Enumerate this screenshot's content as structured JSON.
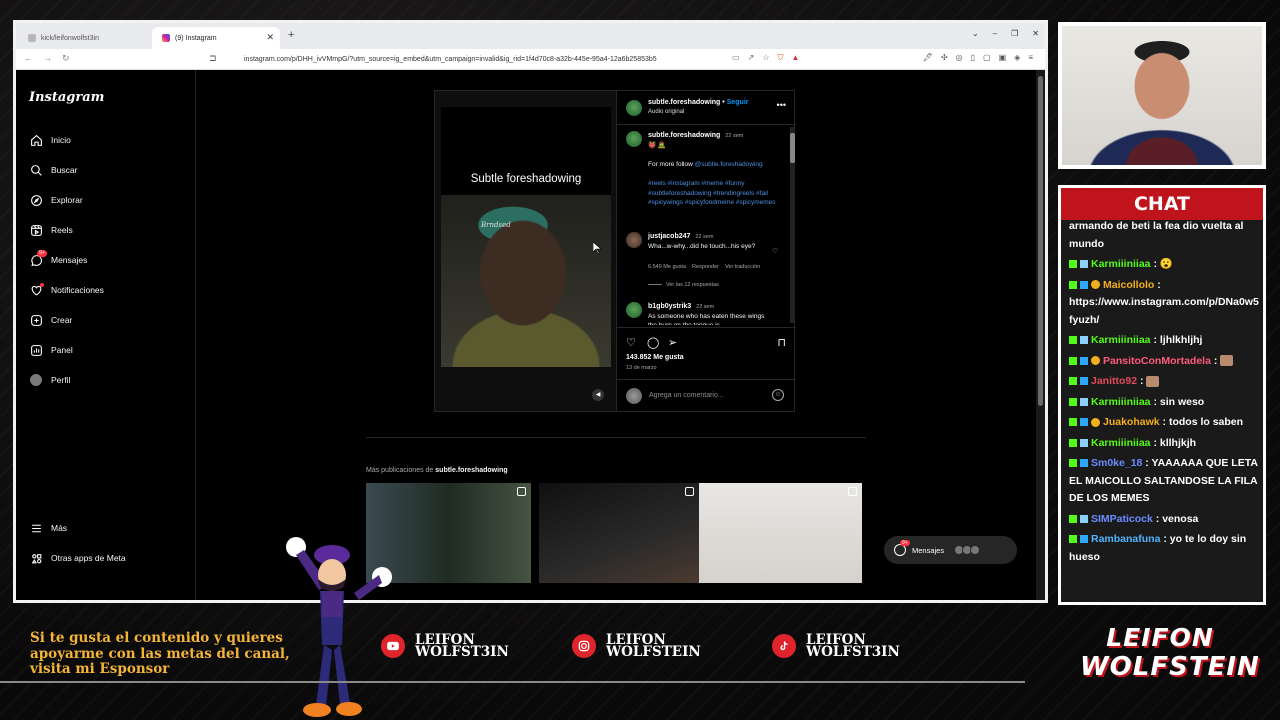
{
  "browser": {
    "tabs": [
      {
        "title": "kick/leifonwolfst3in",
        "active": false
      },
      {
        "title": "(9) Instagram",
        "active": true
      }
    ],
    "url": "instagram.com/p/DHH_ivVMmpG/?utm_source=ig_embed&utm_campaign=invalid&ig_rid=1f4d70c8-a32b-445e-95a4-12a6b25853b5"
  },
  "instagram": {
    "logo": "Instagram",
    "nav": [
      {
        "label": "Inicio",
        "icon": "home-icon"
      },
      {
        "label": "Buscar",
        "icon": "search-icon"
      },
      {
        "label": "Explorar",
        "icon": "compass-icon"
      },
      {
        "label": "Reels",
        "icon": "reels-icon"
      },
      {
        "label": "Mensajes",
        "icon": "messenger-icon",
        "badge": "9+"
      },
      {
        "label": "Notificaciones",
        "icon": "heart-icon"
      },
      {
        "label": "Crear",
        "icon": "plus-icon"
      },
      {
        "label": "Panel",
        "icon": "dashboard-icon"
      },
      {
        "label": "Perfil",
        "icon": "profile-avatar"
      }
    ],
    "nav_bottom": [
      {
        "label": "Más",
        "icon": "menu-icon"
      },
      {
        "label": "Otras apps de Meta",
        "icon": "meta-apps-icon"
      }
    ],
    "post": {
      "video_title": "Subtle foreshadowing",
      "video_caption": "Brndsed",
      "author": "subtle.foreshadowing",
      "follow": "Seguir",
      "audio": "Audio original",
      "caption_time": "22 sem",
      "caption_emojis": "👹 🧟",
      "caption_text": "For more follow",
      "caption_mention": "@subtle.foreshadowing",
      "hashtags": "#reels #instagram #meme #funny #subtleforeshadowing #trendingreels #fail #spicywings #spicyfoodmeme #spicymemes",
      "comments": [
        {
          "user": "justjacob247",
          "time": "22 sem",
          "text": "Wha...w-why...did he touch...his eye?",
          "likes": "6.549 Me gusta",
          "reply": "Responder",
          "translate": "Ver traducción",
          "replies": "Ver las 12 respuestas"
        },
        {
          "user": "b1gb0ystrik3",
          "time": "22 sem",
          "text": "As someone who has eaten these wings the burn on the tongue is"
        }
      ],
      "likes": "143.852 Me gusta",
      "date": "13 de marzo",
      "comment_placeholder": "Agrega un comentario..."
    },
    "more_posts_label": "Más publicaciones de",
    "more_posts_author": "subtle.foreshadowing",
    "messages_button": "Mensajes",
    "messages_badge": "9+"
  },
  "chat": {
    "title": "CHAT",
    "messages": [
      {
        "user": "",
        "text": "armando de beti la fea dio vuelta al mundo",
        "color": "#ffffff",
        "badges": []
      },
      {
        "user": "Karmiiiniiaa",
        "text": "😮",
        "color": "#53fc18",
        "badges": [
          "kick",
          "verified"
        ]
      },
      {
        "user": "Maicollolo",
        "text": "https://www.instagram.com/p/DNa0w5fyuzh/",
        "color": "#f1b01c",
        "badges": [
          "kick",
          "sub",
          "gift"
        ]
      },
      {
        "user": "Karmiiiniiaa",
        "text": "ljhlkhljhj",
        "color": "#53fc18",
        "badges": [
          "kick",
          "verified"
        ]
      },
      {
        "user": "PansitoConMortadela",
        "text": "",
        "color": "#ff5a7a",
        "badges": [
          "kick",
          "mod",
          "gift"
        ],
        "emote": true
      },
      {
        "user": "Janitto92",
        "text": "",
        "color": "#e04a5a",
        "badges": [
          "kick",
          "sub"
        ],
        "emote": true
      },
      {
        "user": "Karmiiiniiaa",
        "text": "sin weso",
        "color": "#53fc18",
        "badges": [
          "kick",
          "verified"
        ]
      },
      {
        "user": "Juakohawk",
        "text": "todos lo saben",
        "color": "#f1b01c",
        "badges": [
          "kick",
          "mod",
          "gift"
        ]
      },
      {
        "user": "Karmiiiniiaa",
        "text": "kllhjkjh",
        "color": "#53fc18",
        "badges": [
          "kick",
          "verified"
        ]
      },
      {
        "user": "Sm0ke_18",
        "text": "YAAAAAA QUE LETA EL MAICOLLO SALTANDOSE LA FILA DE LOS MEMES",
        "color": "#6b8cff",
        "badges": [
          "kick",
          "mod"
        ]
      },
      {
        "user": "SIMPaticock",
        "text": "venosa",
        "color": "#6b8cff",
        "badges": [
          "kick",
          "verified"
        ]
      },
      {
        "user": "Rambanafuna",
        "text": "yo te lo doy sin hueso",
        "color": "#4fb4ff",
        "badges": [
          "kick",
          "sub"
        ]
      }
    ]
  },
  "footer": {
    "promo": "Si te gusta el contenido y quieres apoyarme con las metas del canal, visita mi Esponsor",
    "socials": [
      {
        "platform": "youtube",
        "line1": "LEIFON",
        "line2": "WOLFST3IN"
      },
      {
        "platform": "instagram",
        "line1": "LEIFON",
        "line2": "WOLFSTEIN"
      },
      {
        "platform": "tiktok",
        "line1": "LEIFON",
        "line2": "WOLFST3IN"
      }
    ],
    "logo_line1": "LEIFON",
    "logo_line2": "WOLFSTEIN"
  }
}
